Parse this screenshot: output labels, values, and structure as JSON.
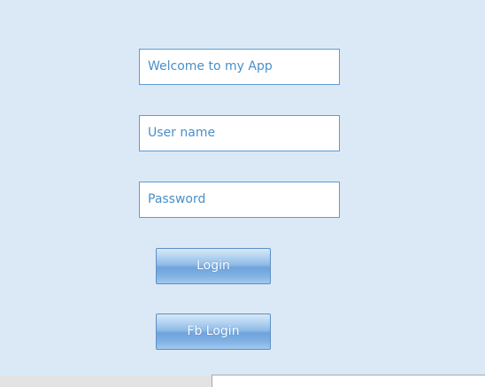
{
  "welcome": {
    "text": "Welcome to my App"
  },
  "username": {
    "placeholder": "User name"
  },
  "password": {
    "placeholder": "Password"
  },
  "buttons": {
    "login_label": "Login",
    "fb_login_label": "Fb Login"
  },
  "colors": {
    "background": "#dbe9f6",
    "field_border": "#5b9bd5",
    "field_text": "#4a8fc8",
    "button_gradient_top": "#d8e8f7",
    "button_gradient_mid": "#6fa3dc",
    "button_text": "#ffffff"
  }
}
